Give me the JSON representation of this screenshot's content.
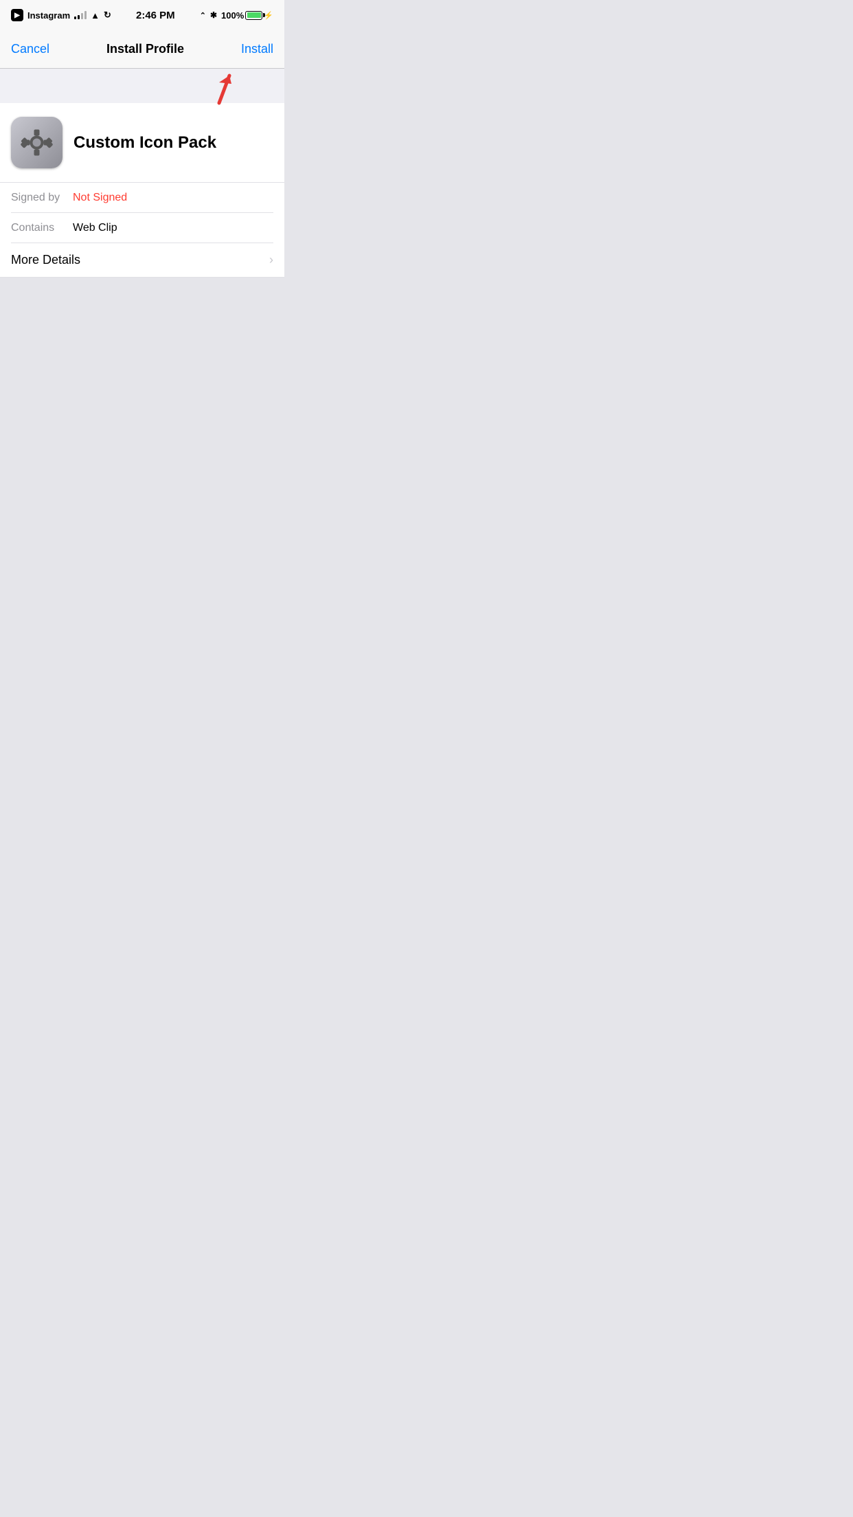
{
  "statusBar": {
    "appName": "Instagram",
    "time": "2:46 PM",
    "battery": "100%",
    "batteryFill": "100"
  },
  "navBar": {
    "cancelLabel": "Cancel",
    "title": "Install Profile",
    "installLabel": "Install"
  },
  "profile": {
    "name": "Custom Icon Pack",
    "signedByLabel": "Signed by",
    "signedByValue": "Not Signed",
    "containsLabel": "Contains",
    "containsValue": "Web Clip"
  },
  "moreDetails": {
    "label": "More Details"
  }
}
